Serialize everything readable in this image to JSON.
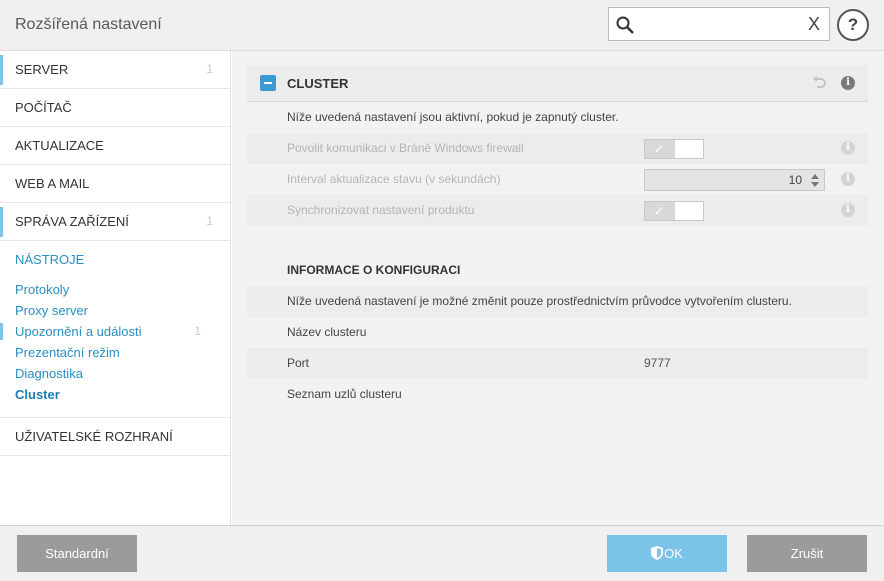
{
  "window": {
    "title": "Rozšířená nastavení"
  },
  "search": {
    "placeholder": "",
    "value": "",
    "clear_glyph": "X"
  },
  "help": {
    "glyph": "?"
  },
  "sidebar": {
    "items": [
      {
        "label": "SERVER",
        "count": "1"
      },
      {
        "label": "POČÍTAČ",
        "count": ""
      },
      {
        "label": "AKTUALIZACE",
        "count": ""
      },
      {
        "label": "WEB A MAIL",
        "count": ""
      },
      {
        "label": "SPRÁVA ZAŘÍZENÍ",
        "count": "1"
      }
    ],
    "tools": {
      "title": "NÁSTROJE",
      "subitems": [
        {
          "label": "Protokoly",
          "count": ""
        },
        {
          "label": "Proxy server",
          "count": ""
        },
        {
          "label": "Upozornění a události",
          "count": "1"
        },
        {
          "label": "Prezentační režim",
          "count": ""
        },
        {
          "label": "Diagnostika",
          "count": ""
        },
        {
          "label": "Cluster",
          "count": ""
        }
      ]
    },
    "ui_item": {
      "label": "UŽIVATELSKÉ ROZHRANÍ"
    }
  },
  "panel": {
    "title": "CLUSTER",
    "intro": "Níže uvedená nastavení jsou aktivní, pokud je zapnutý cluster.",
    "settings": {
      "firewall": {
        "label": "Povolit komunikaci v Bráně Windows firewall",
        "enabled": true
      },
      "interval": {
        "label": "Interval aktualizace stavu (v sekundách)",
        "value": "10"
      },
      "sync": {
        "label": "Synchronizovat nastavení produktu",
        "enabled": true
      }
    },
    "config": {
      "title": "INFORMACE O KONFIGURACI",
      "note": "Níže uvedená nastavení je možné změnit pouze prostřednictvím průvodce vytvořením clusteru.",
      "name_label": "Název clusteru",
      "name_value": "",
      "port_label": "Port",
      "port_value": "9777",
      "nodes_label": "Seznam uzlů clusteru",
      "nodes_value": ""
    }
  },
  "footer": {
    "standard_label": "Standardní",
    "ok_label": "OK",
    "cancel_label": "Zrušit"
  },
  "colors": {
    "accent": "#2a8fc5",
    "ok_button": "#7cc3e8",
    "gray_button": "#9b9b9b",
    "marker": "#7fc3e6"
  },
  "icons": [
    "search-icon",
    "clear-icon",
    "help-icon",
    "collapse-icon",
    "undo-icon",
    "info-icon",
    "check-icon",
    "shield-icon"
  ]
}
